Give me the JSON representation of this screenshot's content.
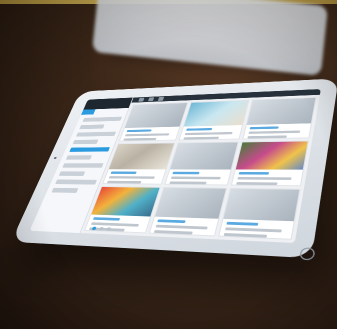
{
  "scene": {
    "subject": "tablet-on-wooden-table",
    "accent_color": "#2b9be0",
    "table_color": "#3a2618",
    "device_color": "#e6ebef"
  },
  "tablet_ui": {
    "sidebar_items": [
      "",
      "",
      "",
      "",
      "",
      "",
      "",
      "",
      "",
      ""
    ],
    "cards": [
      {
        "image": "img-plain"
      },
      {
        "image": "img-beach"
      },
      {
        "image": "img-plain"
      },
      {
        "image": "img-shells"
      },
      {
        "image": "img-plain"
      },
      {
        "image": "img-crowd"
      },
      {
        "image": "img-color"
      },
      {
        "image": "img-plain"
      },
      {
        "image": "img-plain"
      }
    ]
  }
}
